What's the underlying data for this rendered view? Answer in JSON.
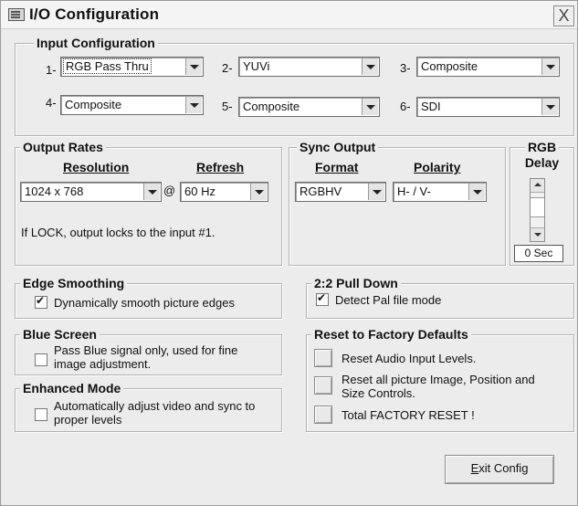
{
  "window": {
    "title": "I/O Configuration",
    "close_glyph": "X"
  },
  "input_config": {
    "legend": "Input Configuration",
    "slots": [
      {
        "label": "1-",
        "value": "RGB Pass Thru"
      },
      {
        "label": "2-",
        "value": "YUVi"
      },
      {
        "label": "3-",
        "value": "Composite"
      },
      {
        "label": "4-",
        "value": "Composite"
      },
      {
        "label": "5-",
        "value": "Composite"
      },
      {
        "label": "6-",
        "value": "SDI"
      }
    ]
  },
  "output_rates": {
    "legend": "Output Rates",
    "resolution_header": "Resolution",
    "refresh_header": "Refresh",
    "resolution_value": "1024 x 768",
    "at_symbol": "@",
    "refresh_value": "60 Hz",
    "note": "If LOCK, output locks to the input #1."
  },
  "sync_output": {
    "legend": "Sync Output",
    "format_header": "Format",
    "polarity_header": "Polarity",
    "format_value": "RGBHV",
    "polarity_value": "H- / V-"
  },
  "rgb_delay": {
    "title_line1": "RGB",
    "title_line2": "Delay",
    "value": "0 Sec"
  },
  "edge_smoothing": {
    "legend": "Edge Smoothing",
    "checkbox_label": "Dynamically smooth picture edges",
    "checked": true
  },
  "pull_down": {
    "legend": "2:2 Pull Down",
    "checkbox_label": "Detect Pal file mode",
    "checked": true
  },
  "blue_screen": {
    "legend": "Blue Screen",
    "line1": "Pass Blue signal only, used for fine",
    "line2": "image adjustment.",
    "checked": false
  },
  "enhanced_mode": {
    "legend": "Enhanced Mode",
    "line1": "Automatically adjust video and sync to",
    "line2": "proper levels",
    "checked": false
  },
  "reset": {
    "legend": "Reset to Factory Defaults",
    "audio": "Reset Audio Input Levels.",
    "picture_line1": "Reset all picture Image, Position and",
    "picture_line2": "Size Controls.",
    "total": "Total FACTORY RESET !"
  },
  "exit": {
    "mnemonic": "E",
    "rest": "xit Config"
  }
}
